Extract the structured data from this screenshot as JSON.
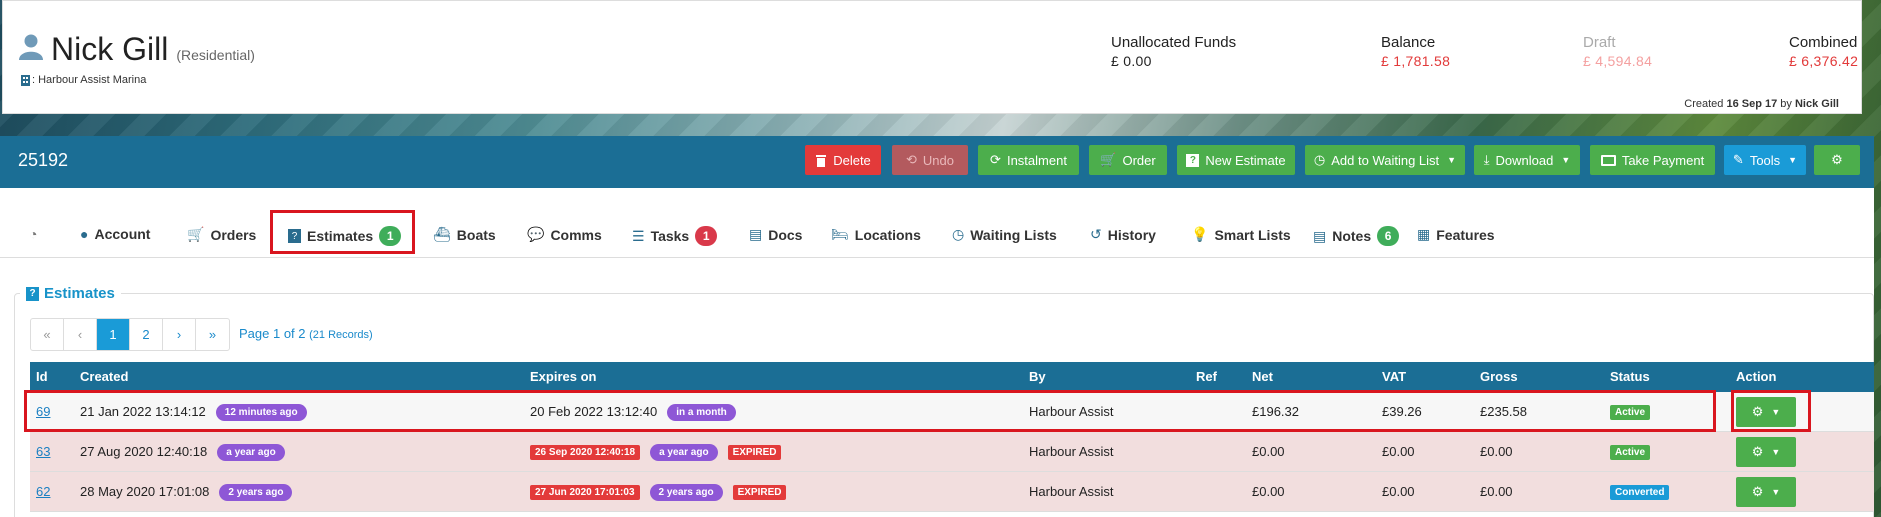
{
  "header": {
    "customer_name": "Nick Gill",
    "customer_type": "(Residential)",
    "marina": ": Harbour Assist Marina",
    "funds": [
      {
        "label": "Unallocated Funds",
        "value": "£ 0.00",
        "color": "#222222"
      },
      {
        "label": "Balance",
        "value": "£ 1,781.58",
        "color": "#e23a3a"
      },
      {
        "label": "Draft",
        "value": "£ 4,594.84",
        "color": "#f4a0a0"
      },
      {
        "label": "Combined",
        "value": "£ 6,376.42",
        "color": "#e23a3a"
      }
    ],
    "created_prefix": "Created",
    "created_date": "16 Sep 17",
    "created_by_prefix": "by",
    "created_by": "Nick Gill"
  },
  "toolbar": {
    "account_number": "25192",
    "buttons": [
      {
        "label": "Delete",
        "icon": "trash-icon",
        "color": "#e33a3a"
      },
      {
        "label": "Undo",
        "icon": "undo-icon",
        "color": "#b35a5e"
      },
      {
        "label": "Instalment",
        "icon": "refresh-icon",
        "color": "#4cae4c"
      },
      {
        "label": "Order",
        "icon": "cart-icon",
        "color": "#4cae4c"
      },
      {
        "label": "New Estimate",
        "icon": "question-icon",
        "color": "#4cae4c"
      },
      {
        "label": "Add to Waiting List",
        "icon": "clock-icon",
        "color": "#4cae4c"
      },
      {
        "label": "Download",
        "icon": "download-icon",
        "color": "#4cae4c"
      },
      {
        "label": "Take Payment",
        "icon": "card-icon",
        "color": "#4cae4c"
      },
      {
        "label": "Tools",
        "icon": "wand-icon",
        "color": "#1a9bd7"
      },
      {
        "label": "",
        "icon": "gear-icon",
        "color": "#4cae4c"
      }
    ]
  },
  "tabs": [
    {
      "label": "",
      "icon": "dashboard-icon"
    },
    {
      "label": "Account",
      "icon": "user-icon"
    },
    {
      "label": "Orders",
      "icon": "cart-icon"
    },
    {
      "label": "Estimates",
      "icon": "question-icon",
      "badge": "1",
      "badge_color": "#3fad5a"
    },
    {
      "label": "Boats",
      "icon": "ship-icon"
    },
    {
      "label": "Comms",
      "icon": "chat-icon"
    },
    {
      "label": "Tasks",
      "icon": "tasks-icon",
      "badge": "1",
      "badge_color": "#d9394a"
    },
    {
      "label": "Docs",
      "icon": "doc-icon"
    },
    {
      "label": "Locations",
      "icon": "bed-icon"
    },
    {
      "label": "Waiting Lists",
      "icon": "clock-icon"
    },
    {
      "label": "History",
      "icon": "history-icon"
    },
    {
      "label": "Smart Lists",
      "icon": "bulb-icon"
    },
    {
      "label": "Notes",
      "icon": "note-icon",
      "badge": "6",
      "badge_color": "#3fad5a"
    },
    {
      "label": "Features",
      "icon": "grid-icon"
    }
  ],
  "estimates": {
    "title": "Estimates",
    "pagination": {
      "pages": [
        "«",
        "‹",
        "1",
        "2",
        "›",
        "»"
      ],
      "info": "Page 1 of 2",
      "records": "(21 Records)"
    },
    "columns": [
      "Id",
      "Created",
      "Expires on",
      "By",
      "Ref",
      "Net",
      "VAT",
      "Gross",
      "Status",
      "Action"
    ],
    "rows": [
      {
        "id": "69",
        "created": "21 Jan 2022 13:14:12",
        "created_ago": "12 minutes ago",
        "expires": "20 Feb 2022 13:12:40",
        "expires_ago": "in a month",
        "expired_label": "",
        "by": "Harbour Assist",
        "ref": "",
        "net": "£196.32",
        "vat": "£39.26",
        "gross": "£235.58",
        "status": "Active",
        "status_color": "#4cae4c",
        "row_bg": "#f7f7f7"
      },
      {
        "id": "63",
        "created": "27 Aug 2020 12:40:18",
        "created_ago": "a year ago",
        "expires": "26 Sep 2020 12:40:18",
        "expires_ago": "a year ago",
        "expired_label": "EXPIRED",
        "by": "Harbour Assist",
        "ref": "",
        "net": "£0.00",
        "vat": "£0.00",
        "gross": "£0.00",
        "status": "Active",
        "status_color": "#4cae4c",
        "row_bg": "#f2dede"
      },
      {
        "id": "62",
        "created": "28 May 2020 17:01:08",
        "created_ago": "2 years ago",
        "expires": "27 Jun 2020 17:01:03",
        "expires_ago": "2 years ago",
        "expired_label": "EXPIRED",
        "by": "Harbour Assist",
        "ref": "",
        "net": "£0.00",
        "vat": "£0.00",
        "gross": "£0.00",
        "status": "Converted",
        "status_color": "#1a9bd7",
        "row_bg": "#f2dede"
      }
    ]
  }
}
